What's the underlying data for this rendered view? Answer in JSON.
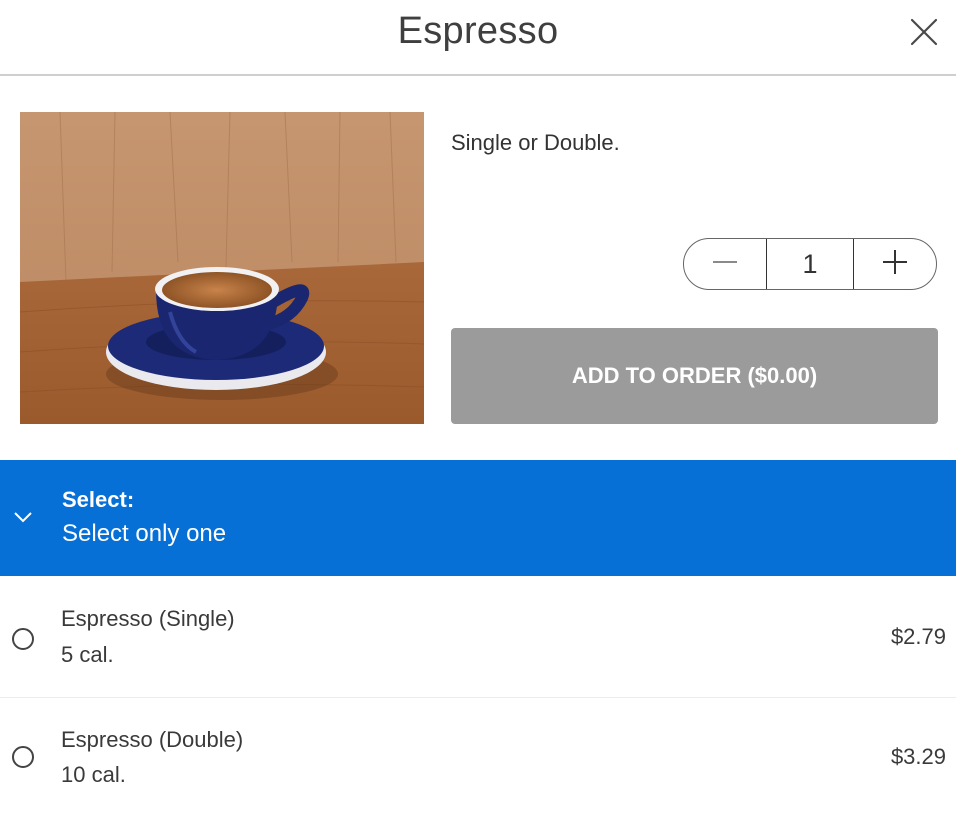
{
  "header": {
    "title": "Espresso",
    "close_icon": "close-icon"
  },
  "item": {
    "image_icon": "espresso-cup-photo",
    "description": "Single or Double.",
    "quantity": {
      "value": "1",
      "decrement_icon": "minus-icon",
      "increment_icon": "plus-icon"
    },
    "add_button_label": "ADD TO ORDER ($0.00)"
  },
  "options_group": {
    "title": "Select:",
    "subtitle": "Select only one",
    "chevron_icon": "chevron-down-icon",
    "color": "#0770d6",
    "options": [
      {
        "name": "Espresso (Single)",
        "calories": "5 cal.",
        "price": "$2.79"
      },
      {
        "name": "Espresso (Double)",
        "calories": "10 cal.",
        "price": "$3.29"
      }
    ]
  },
  "colors": {
    "add_button_disabled": "#9b9b9b",
    "accent": "#0770d6"
  }
}
